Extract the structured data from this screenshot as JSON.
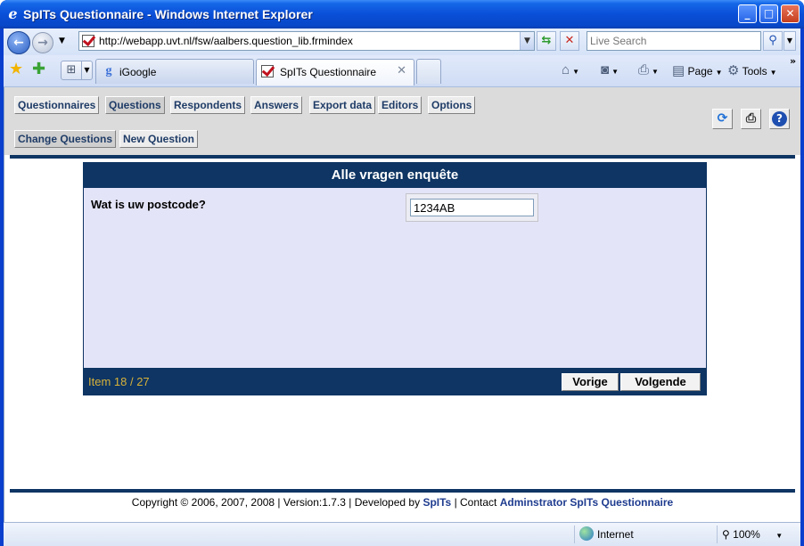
{
  "window": {
    "title": "SpITs Questionnaire - Windows Internet Explorer",
    "min_glyph": "_",
    "max_glyph": "□",
    "close_glyph": "✕"
  },
  "toolbar": {
    "address": "http://webapp.uvt.nl/fsw/aalbers.question_lib.frmindex",
    "search_placeholder": "Live Search",
    "tabs": [
      {
        "label": "iGoogle"
      },
      {
        "label": "SpITs Questionnaire"
      }
    ],
    "commands": {
      "page": "Page",
      "tools": "Tools"
    }
  },
  "app": {
    "nav": [
      "Questionnaires",
      "Questions",
      "Respondents",
      "Answers",
      "Export data",
      "Editors",
      "Options"
    ],
    "active_nav": "Questions",
    "subnav": [
      "Change Questions",
      "New Question"
    ],
    "panel_title": "Alle vragen enquête",
    "question": "Wat is uw postcode?",
    "answer_value": "1234AB",
    "item_counter": "Item 18 / 27",
    "prev_label": "Vorige",
    "next_label": "Volgende"
  },
  "footer": {
    "text_prefix": "Copyright © 2006, 2007, 2008 | Version:1.7.3 | Developed by",
    "developer_link": "SpITs",
    "text_middle": "| Contact",
    "contact_link": "Adminstrator SpITs Questionnaire"
  },
  "status": {
    "zone": "Internet",
    "zoom": "100%"
  },
  "colors": {
    "navy": "#0e3563",
    "panel_bg": "#e4e4f8",
    "counter_text": "#d7b13a",
    "nav_text": "#1f3c67"
  }
}
